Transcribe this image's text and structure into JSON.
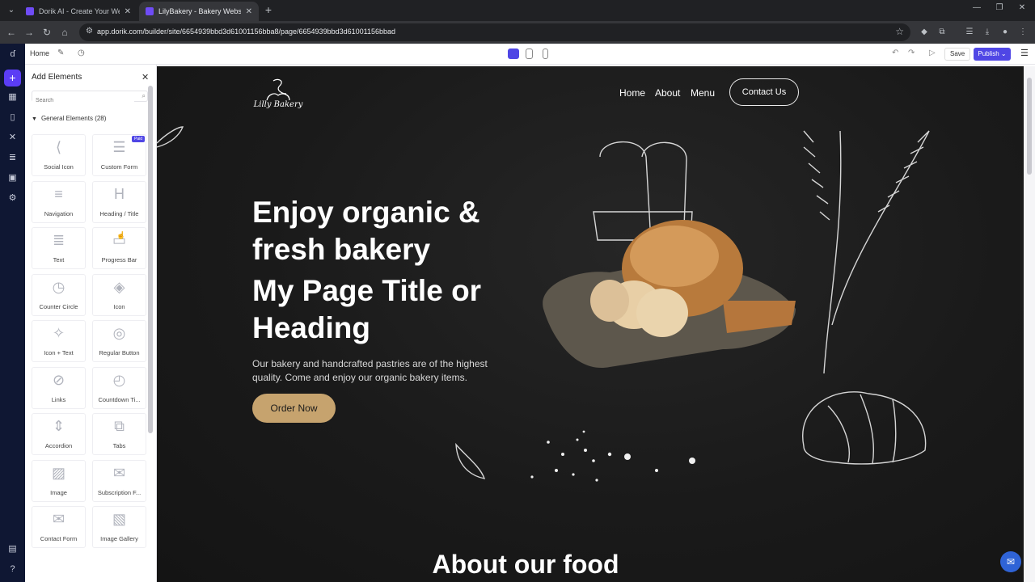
{
  "browser": {
    "tabs": [
      {
        "title": "Dorik AI - Create Your Website",
        "active": false
      },
      {
        "title": "LilyBakery - Bakery Website Ten",
        "active": true
      }
    ],
    "url": "app.dorik.com/builder/site/6654939bbd3d61001156bba8/page/6654939bbd3d61001156bbad"
  },
  "builder": {
    "page_name": "Home",
    "save_label": "Save",
    "publish_label": "Publish",
    "panel": {
      "title": "Add Elements",
      "search_placeholder": "Search",
      "group_label": "General Elements (28)",
      "paid_badge": "Paid",
      "elements": [
        {
          "label": "Social Icon",
          "icon": "share-icon",
          "glyph": "⟨"
        },
        {
          "label": "Custom Form",
          "icon": "form-icon",
          "glyph": "☰",
          "paid": true
        },
        {
          "label": "Navigation",
          "icon": "menu-icon",
          "glyph": "≡"
        },
        {
          "label": "Heading / Title",
          "icon": "heading-icon",
          "glyph": "H"
        },
        {
          "label": "Text",
          "icon": "text-icon",
          "glyph": "≣"
        },
        {
          "label": "Progress Bar",
          "icon": "progress-icon",
          "glyph": "▭"
        },
        {
          "label": "Counter Circle",
          "icon": "clock-icon",
          "glyph": "◷"
        },
        {
          "label": "Icon",
          "icon": "shapes-icon",
          "glyph": "◈"
        },
        {
          "label": "Icon + Text",
          "icon": "icon-text-icon",
          "glyph": "✧"
        },
        {
          "label": "Regular Button",
          "icon": "pointer-icon",
          "glyph": "◎"
        },
        {
          "label": "Links",
          "icon": "link-icon",
          "glyph": "⊘"
        },
        {
          "label": "Countdown Ti...",
          "icon": "stopwatch-icon",
          "glyph": "◴"
        },
        {
          "label": "Accordion",
          "icon": "accordion-icon",
          "glyph": "⇕"
        },
        {
          "label": "Tabs",
          "icon": "tabs-icon",
          "glyph": "⧉"
        },
        {
          "label": "Image",
          "icon": "image-icon",
          "glyph": "▨"
        },
        {
          "label": "Subscription F...",
          "icon": "subscription-icon",
          "glyph": "✉"
        },
        {
          "label": "Contact Form",
          "icon": "contact-form-icon",
          "glyph": "✉"
        },
        {
          "label": "Image Gallery",
          "icon": "gallery-icon",
          "glyph": "▧"
        }
      ]
    }
  },
  "site": {
    "logo_text": "Lilly Bakery",
    "nav": [
      "Home",
      "About",
      "Menu"
    ],
    "contact_label": "Contact Us",
    "hero_title": "Enjoy organic & fresh bakery",
    "hero_subtitle": "My Page Title or Heading",
    "hero_desc": "Our bakery and handcrafted pastries are of the highest quality. Come and enjoy our organic bakery items.",
    "cta_label": "Order Now",
    "about_heading": "About our food"
  },
  "colors": {
    "accent": "#4f46e5",
    "rail": "#0f1733",
    "cta": "#c6a36e",
    "canvas_bg": "#181818"
  }
}
